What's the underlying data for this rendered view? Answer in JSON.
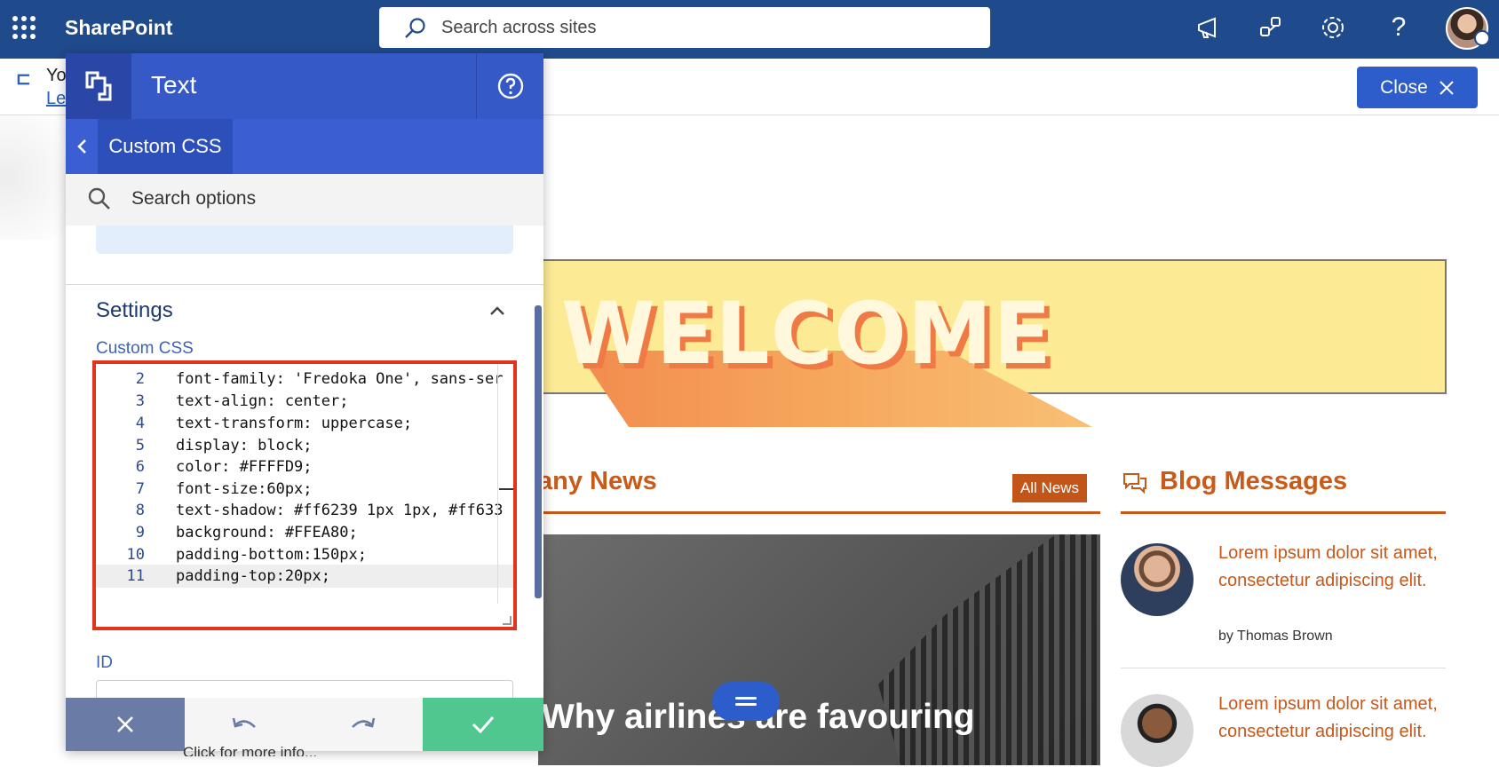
{
  "topbar": {
    "brand": "SharePoint",
    "search_placeholder": "Search across sites",
    "icons": [
      "megaphone-icon",
      "share-network-icon",
      "gear-icon",
      "help-icon"
    ],
    "help_glyph": "?"
  },
  "subbar": {
    "text_partial": "Yo",
    "link_partial": "Le",
    "close_label": "Close"
  },
  "panel": {
    "title": "Text",
    "breadcrumb": "Custom CSS",
    "search_placeholder": "Search options",
    "settings_title": "Settings",
    "css_label": "Custom CSS",
    "code_lines": [
      {
        "n": "2",
        "code": "font-family: 'Fredoka One', sans-ser"
      },
      {
        "n": "3",
        "code": "text-align: center;"
      },
      {
        "n": "4",
        "code": "text-transform: uppercase;"
      },
      {
        "n": "5",
        "code": "display: block;"
      },
      {
        "n": "6",
        "code": "color: #FFFFD9;"
      },
      {
        "n": "7",
        "code": "font-size:60px;"
      },
      {
        "n": "8",
        "code": "text-shadow: #ff6239 1px 1px, #ff633"
      },
      {
        "n": "9",
        "code": "background: #FFEA80;"
      },
      {
        "n": "10",
        "code": "padding-bottom:150px;"
      },
      {
        "n": "11",
        "code": "padding-top:20px;"
      }
    ],
    "id_label": "ID",
    "under_text": "Click for more info..."
  },
  "page": {
    "welcome": "WELCOME",
    "news_title": "any News",
    "all_news": "All News",
    "news_headline": "Why airlines are favouring",
    "blog_title": "Blog Messages",
    "blog_items": [
      {
        "text": "Lorem ipsum dolor sit amet, consectetur adipiscing elit.",
        "by": "by Thomas Brown"
      },
      {
        "text": "Lorem ipsum dolor sit amet, consectetur adipiscing elit.",
        "by": ""
      }
    ]
  },
  "colors": {
    "suite_bar": "#1f4a8c",
    "panel_blue": "#3559c7",
    "accent_orange": "#c8581a",
    "welcome_bg": "#fceb94",
    "ok_green": "#4fc78f",
    "editor_highlight": "#e0341f"
  }
}
